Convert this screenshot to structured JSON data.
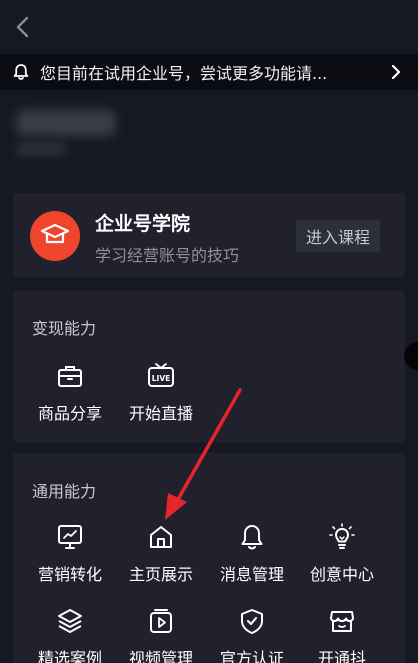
{
  "notice": {
    "text": "您目前在试用企业号，尝试更多功能请..."
  },
  "academy": {
    "title": "企业号学院",
    "subtitle": "学习经营账号的技巧",
    "enter_label": "进入课程",
    "badge_color": "#f0452d"
  },
  "monetize": {
    "title": "变现能力",
    "items": [
      {
        "label": "商品分享",
        "icon": "shopping-bag-icon"
      },
      {
        "label": "开始直播",
        "icon": "live-tv-icon"
      }
    ]
  },
  "general": {
    "title": "通用能力",
    "items": [
      {
        "label": "营销转化",
        "icon": "chart-monitor-icon"
      },
      {
        "label": "主页展示",
        "icon": "home-icon"
      },
      {
        "label": "消息管理",
        "icon": "bell-icon"
      },
      {
        "label": "创意中心",
        "icon": "lightbulb-icon"
      },
      {
        "label": "精选案例",
        "icon": "layers-icon"
      },
      {
        "label": "视频管理",
        "icon": "video-play-icon"
      },
      {
        "label": "官方认证",
        "icon": "shield-check-icon"
      },
      {
        "label": "开通抖",
        "icon": "store-icon"
      }
    ]
  },
  "colors": {
    "background": "#161823",
    "card": "#20212c",
    "accent_red": "#f0452d",
    "annotation_arrow": "#e8242b"
  }
}
